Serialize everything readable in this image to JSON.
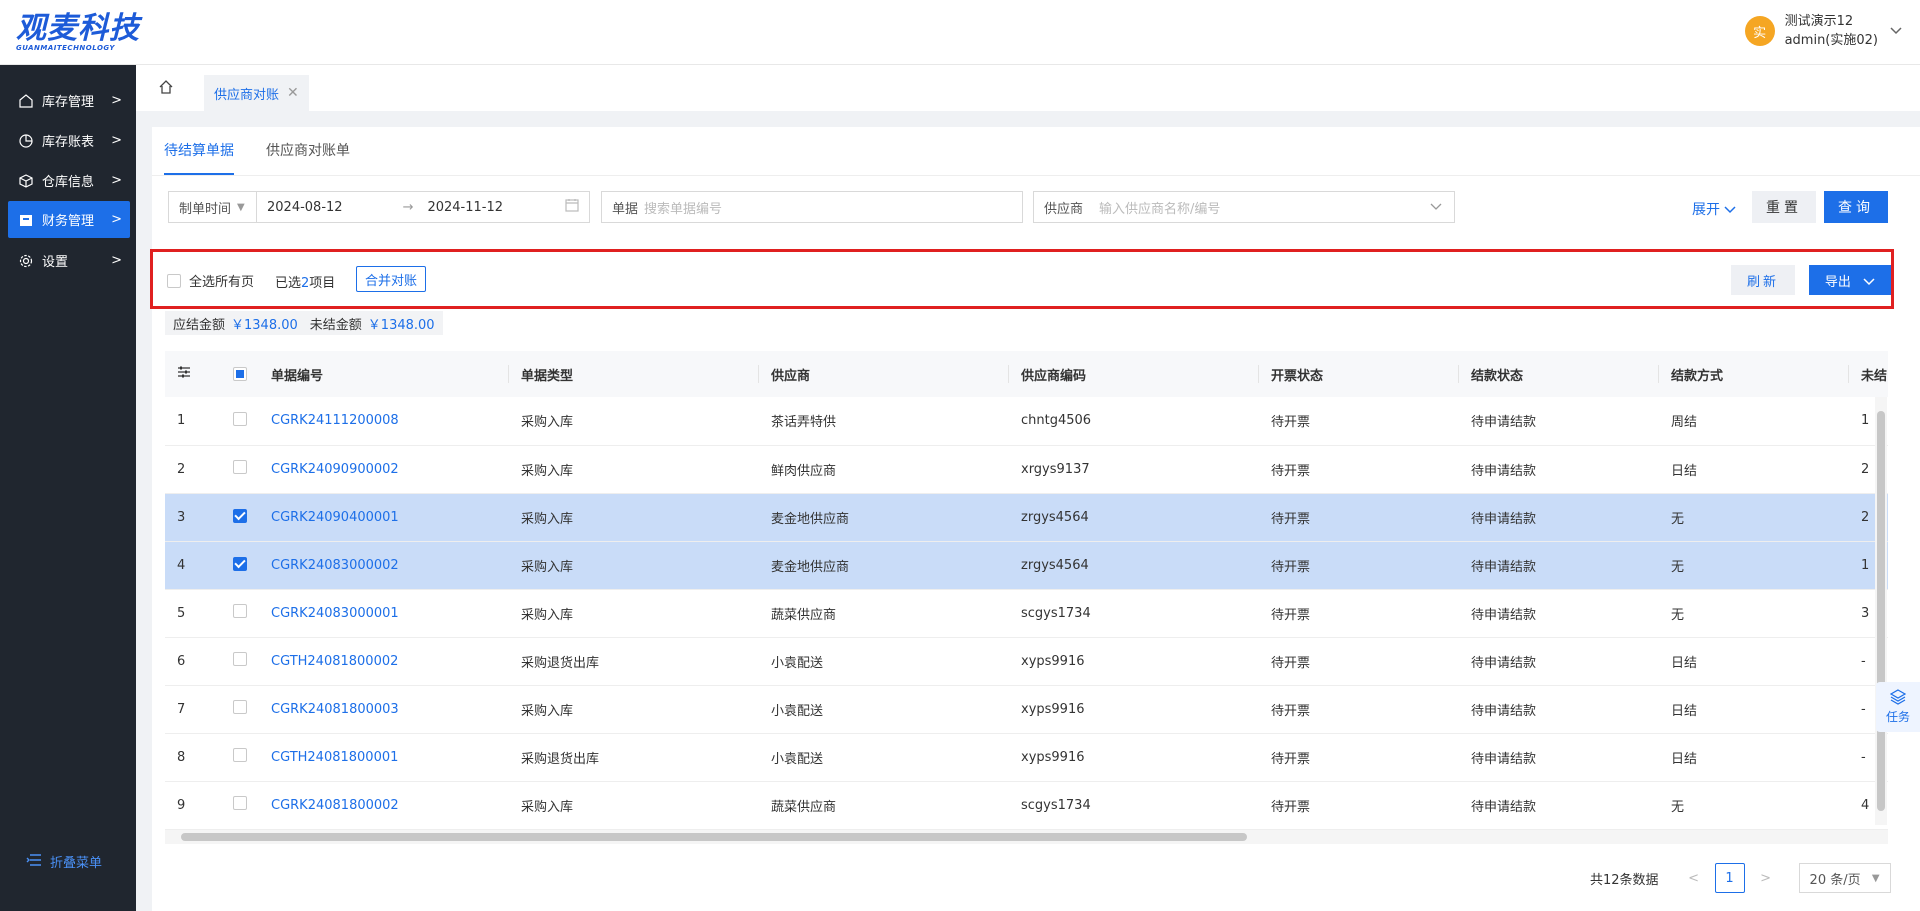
{
  "brand": {
    "logo_text": "观麦科技",
    "logo_sub": "GUANMAITECHNOLOGY"
  },
  "user": {
    "avatar_char": "实",
    "name": "测试演示12",
    "account": "admin(实施02)"
  },
  "sidebar": {
    "items": [
      {
        "label": "库存管理",
        "icon": "home-icon"
      },
      {
        "label": "库存账表",
        "icon": "chart-icon"
      },
      {
        "label": "仓库信息",
        "icon": "box-icon"
      },
      {
        "label": "财务管理",
        "icon": "wallet-icon",
        "active": true
      },
      {
        "label": "设置",
        "icon": "gear-icon"
      }
    ],
    "collapse_label": "折叠菜单"
  },
  "tabs": {
    "current": "供应商对账"
  },
  "subtabs": [
    "待结算单据",
    "供应商对账单"
  ],
  "filters": {
    "date_type": "制单时间",
    "date_start": "2024-08-12",
    "date_end": "2024-11-12",
    "doc_label": "单据",
    "doc_placeholder": "搜索单据编号",
    "supplier_label": "供应商",
    "supplier_placeholder": "输入供应商名称/编号",
    "expand_label": "展开",
    "reset_label": "重置",
    "query_label": "查询"
  },
  "action_bar": {
    "select_all_label": "全选所有页",
    "selected_prefix": "已选",
    "selected_count": "2",
    "selected_suffix": "项目",
    "merge_label": "合并对账",
    "refresh_label": "刷新",
    "export_label": "导出"
  },
  "totals": {
    "payable_label": "应结金额",
    "payable_value": "￥1348.00",
    "unsettled_label": "未结金额",
    "unsettled_value": "￥1348.00"
  },
  "table": {
    "columns": [
      "单据编号",
      "单据类型",
      "供应商",
      "供应商编码",
      "开票状态",
      "结款状态",
      "结款方式",
      "未结"
    ],
    "rows": [
      {
        "idx": "1",
        "checked": false,
        "code": "CGRK24111200008",
        "type": "采购入库",
        "supplier": "茶话弄特供",
        "sup_code": "chntg4506",
        "invoice": "待开票",
        "settle": "待申请结款",
        "method": "周结",
        "unsettled": "1"
      },
      {
        "idx": "2",
        "checked": false,
        "code": "CGRK24090900002",
        "type": "采购入库",
        "supplier": "鲜肉供应商",
        "sup_code": "xrgys9137",
        "invoice": "待开票",
        "settle": "待申请结款",
        "method": "日结",
        "unsettled": "2"
      },
      {
        "idx": "3",
        "checked": true,
        "code": "CGRK24090400001",
        "type": "采购入库",
        "supplier": "麦金地供应商",
        "sup_code": "zrgys4564",
        "invoice": "待开票",
        "settle": "待申请结款",
        "method": "无",
        "unsettled": "2"
      },
      {
        "idx": "4",
        "checked": true,
        "code": "CGRK24083000002",
        "type": "采购入库",
        "supplier": "麦金地供应商",
        "sup_code": "zrgys4564",
        "invoice": "待开票",
        "settle": "待申请结款",
        "method": "无",
        "unsettled": "1"
      },
      {
        "idx": "5",
        "checked": false,
        "code": "CGRK24083000001",
        "type": "采购入库",
        "supplier": "蔬菜供应商",
        "sup_code": "scgys1734",
        "invoice": "待开票",
        "settle": "待申请结款",
        "method": "无",
        "unsettled": "3"
      },
      {
        "idx": "6",
        "checked": false,
        "code": "CGTH24081800002",
        "type": "采购退货出库",
        "supplier": "小袁配送",
        "sup_code": "xyps9916",
        "invoice": "待开票",
        "settle": "待申请结款",
        "method": "日结",
        "unsettled": "-"
      },
      {
        "idx": "7",
        "checked": false,
        "code": "CGRK24081800003",
        "type": "采购入库",
        "supplier": "小袁配送",
        "sup_code": "xyps9916",
        "invoice": "待开票",
        "settle": "待申请结款",
        "method": "日结",
        "unsettled": "-"
      },
      {
        "idx": "8",
        "checked": false,
        "code": "CGTH24081800001",
        "type": "采购退货出库",
        "supplier": "小袁配送",
        "sup_code": "xyps9916",
        "invoice": "待开票",
        "settle": "待申请结款",
        "method": "日结",
        "unsettled": "-"
      },
      {
        "idx": "9",
        "checked": false,
        "code": "CGRK24081800002",
        "type": "采购入库",
        "supplier": "蔬菜供应商",
        "sup_code": "scgys1734",
        "invoice": "待开票",
        "settle": "待申请结款",
        "method": "无",
        "unsettled": "4"
      }
    ]
  },
  "pagination": {
    "total_text": "共12条数据",
    "current_page": "1",
    "page_size": "20 条/页"
  },
  "float_task": {
    "label": "任务"
  }
}
